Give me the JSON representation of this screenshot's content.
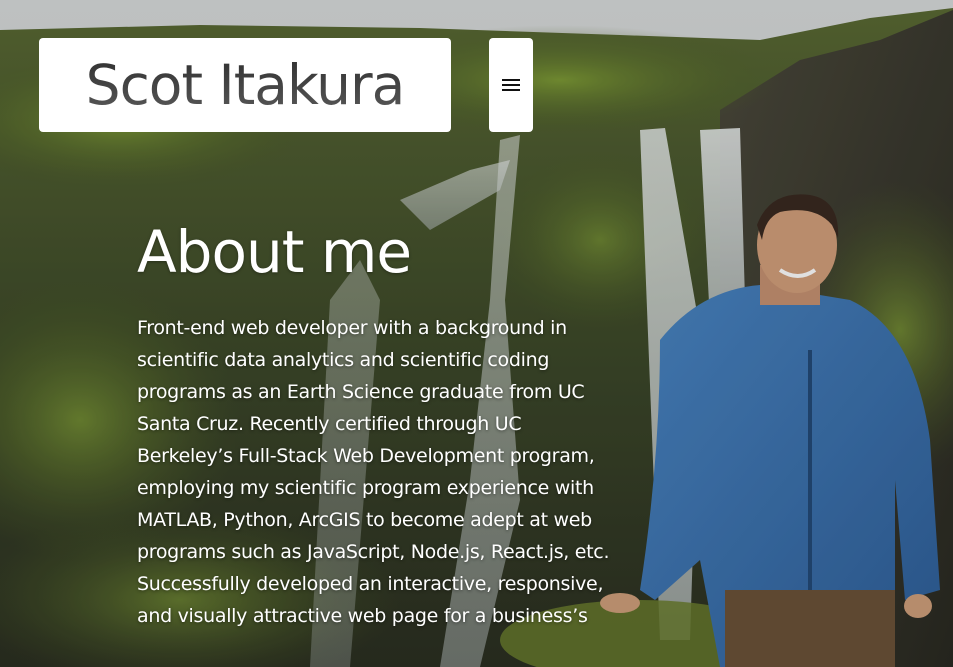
{
  "navbar": {
    "brand_name": "Scot Itakura",
    "menu_icon": "hamburger-menu-icon"
  },
  "about": {
    "title": "About me",
    "body": "Front-end web developer with a background in scientific data analytics and scientific coding programs as an Earth Science graduate from UC Santa Cruz. Recently certified through UC Berkeley’s Full-Stack Web Development program, employing my scientific program experience with MATLAB, Python, ArcGIS to become adept at web programs such as JavaScript, Node.js, React.js, etc. Successfully developed an interactive, responsive, and visually attractive web page for a business’s"
  },
  "theme": {
    "text_color": "#ffffff",
    "navbar_bg": "#ffffff",
    "brand_text_color": "#3f3f3f"
  }
}
